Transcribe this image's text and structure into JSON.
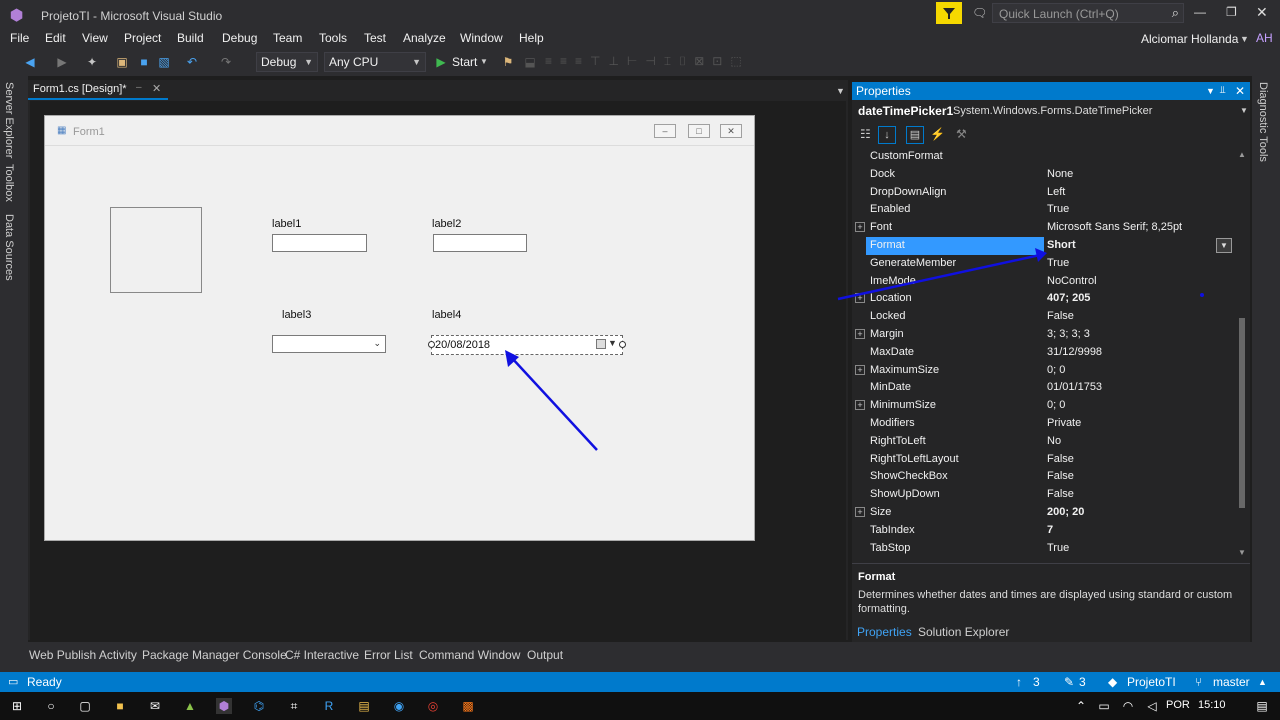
{
  "window": {
    "title": "ProjetoTI - Microsoft Visual Studio",
    "quick_launch_placeholder": "Quick Launch (Ctrl+Q)",
    "user_name": "Alciomar Hollanda",
    "user_initials": "AH"
  },
  "menu": [
    "File",
    "Edit",
    "View",
    "Project",
    "Build",
    "Debug",
    "Team",
    "Tools",
    "Test",
    "Analyze",
    "Window",
    "Help"
  ],
  "toolbar": {
    "config": "Debug",
    "platform": "Any CPU",
    "start_label": "Start"
  },
  "side_tabs": [
    "Server Explorer",
    "Toolbox",
    "Data Sources"
  ],
  "right_side_tab": "Diagnostic Tools",
  "doc_tab": {
    "label": "Form1.cs [Design]*"
  },
  "form": {
    "title": "Form1",
    "labels": {
      "label1": "label1",
      "label2": "label2",
      "label3": "label3",
      "label4": "label4"
    },
    "date_value": "20/08/2018"
  },
  "properties": {
    "header": "Properties",
    "object_name": "dateTimePicker1",
    "object_type": "System.Windows.Forms.DateTimePicker",
    "rows": [
      {
        "name": "CustomFormat",
        "value": "",
        "expandable": false
      },
      {
        "name": "Dock",
        "value": "None",
        "expandable": false
      },
      {
        "name": "DropDownAlign",
        "value": "Left",
        "expandable": false
      },
      {
        "name": "Enabled",
        "value": "True",
        "expandable": false
      },
      {
        "name": "Font",
        "value": "Microsoft Sans Serif; 8,25pt",
        "expandable": true
      },
      {
        "name": "Format",
        "value": "Short",
        "expandable": false,
        "selected": true
      },
      {
        "name": "GenerateMember",
        "value": "True",
        "expandable": false
      },
      {
        "name": "ImeMode",
        "value": "NoControl",
        "expandable": false
      },
      {
        "name": "Location",
        "value": "407; 205",
        "expandable": true,
        "bold": true
      },
      {
        "name": "Locked",
        "value": "False",
        "expandable": false
      },
      {
        "name": "Margin",
        "value": "3; 3; 3; 3",
        "expandable": true
      },
      {
        "name": "MaxDate",
        "value": "31/12/9998",
        "expandable": false
      },
      {
        "name": "MaximumSize",
        "value": "0; 0",
        "expandable": true
      },
      {
        "name": "MinDate",
        "value": "01/01/1753",
        "expandable": false
      },
      {
        "name": "MinimumSize",
        "value": "0; 0",
        "expandable": true
      },
      {
        "name": "Modifiers",
        "value": "Private",
        "expandable": false
      },
      {
        "name": "RightToLeft",
        "value": "No",
        "expandable": false
      },
      {
        "name": "RightToLeftLayout",
        "value": "False",
        "expandable": false
      },
      {
        "name": "ShowCheckBox",
        "value": "False",
        "expandable": false
      },
      {
        "name": "ShowUpDown",
        "value": "False",
        "expandable": false
      },
      {
        "name": "Size",
        "value": "200; 20",
        "expandable": true,
        "bold": true
      },
      {
        "name": "TabIndex",
        "value": "7",
        "expandable": false,
        "bold": true
      },
      {
        "name": "TabStop",
        "value": "True",
        "expandable": false
      }
    ],
    "description_title": "Format",
    "description_text": "Determines whether dates and times are displayed using standard or custom formatting.",
    "tabs": [
      "Properties",
      "Solution Explorer"
    ]
  },
  "bottom_tabs": [
    "Web Publish Activity",
    "Package Manager Console",
    "C# Interactive",
    "Error List",
    "Command Window",
    "Output"
  ],
  "status": {
    "text": "Ready",
    "up_count": "3",
    "edit_count": "3",
    "project": "ProjetoTI",
    "branch": "master"
  },
  "taskbar": {
    "lang": "POR",
    "time": "15:10"
  },
  "colors": {
    "accent": "#007acc",
    "selection": "#3399ff",
    "arrow": "#1010e0"
  }
}
